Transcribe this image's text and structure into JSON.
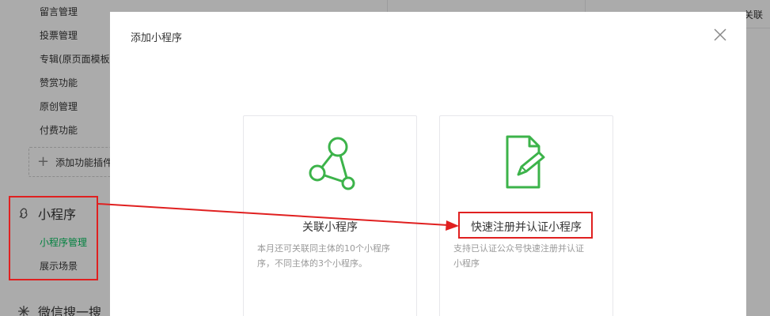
{
  "sidebar": {
    "items_top": [
      "留言管理",
      "投票管理",
      "专辑(原页面模板)",
      "赞赏功能",
      "原创管理",
      "付费功能"
    ],
    "add_plugin": "添加功能插件",
    "miniprogram": {
      "title": "小程序",
      "items": [
        "小程序管理",
        "展示场景"
      ]
    },
    "search": {
      "title": "微信搜一搜"
    }
  },
  "background": {
    "peek_right": "关联"
  },
  "dialog": {
    "title": "添加小程序",
    "cards": [
      {
        "label": "关联小程序",
        "desc_line1": "本月还可关联同主体的10个小程序",
        "desc_line2": "序，不同主体的3个小程序。"
      },
      {
        "label": "快速注册并认证小程序",
        "desc_line1": "支持已认证公众号快速注册并认证",
        "desc_line2": "小程序"
      }
    ]
  },
  "colors": {
    "accent_green": "#07c160",
    "icon_green": "#3cb34a",
    "annotation_red": "#e02020"
  }
}
